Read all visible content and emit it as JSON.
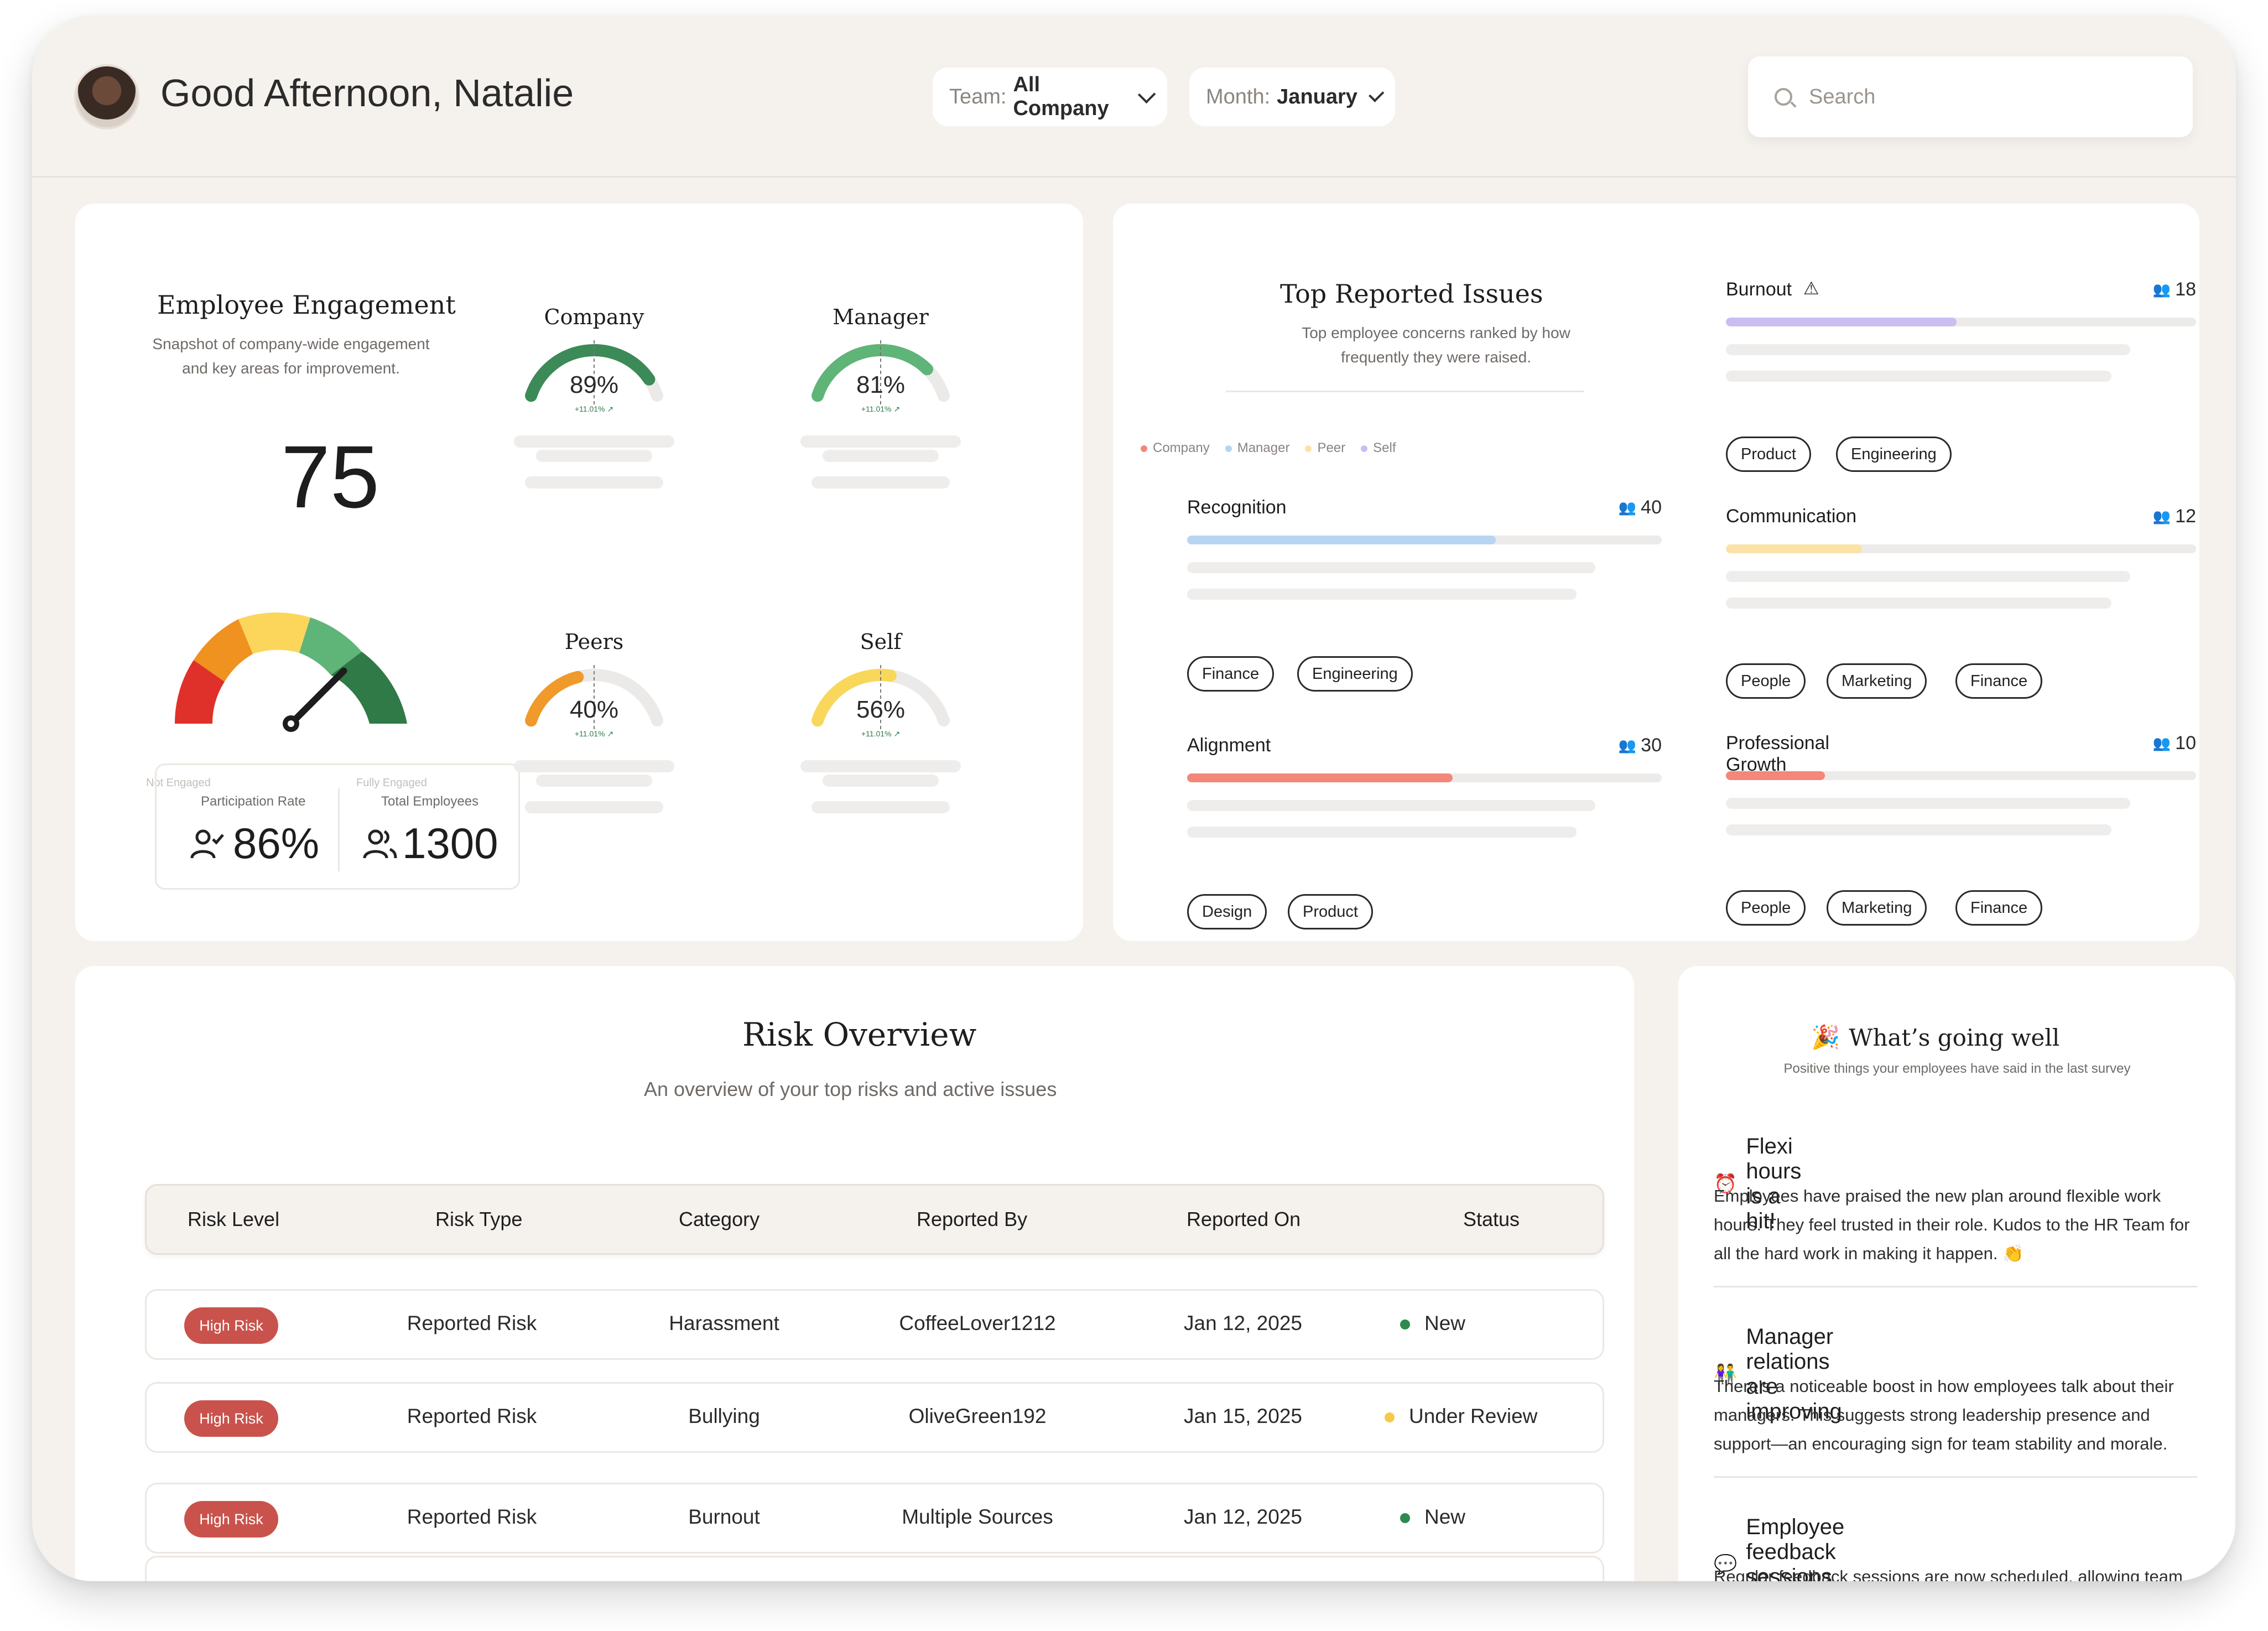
{
  "header": {
    "greeting": "Good Afternoon, Natalie",
    "team_label": "Team:",
    "team_value": "All Company",
    "month_label": "Month:",
    "month_value": "January",
    "search_placeholder": "Search"
  },
  "engagement": {
    "title": "Employee Engagement",
    "subtitle_line1": "Snapshot of company-wide engagement",
    "subtitle_line2": "and key areas for improvement.",
    "score": "75",
    "score_value": 75,
    "min_label": "Not Engaged",
    "max_label": "Fully Engaged",
    "participation_label": "Participation Rate",
    "participation_value": "86%",
    "employees_label": "Total Employees",
    "employees_value": "1300",
    "gauges": [
      {
        "title": "Company",
        "value": "89%",
        "pct": 89,
        "delta": "+11.01% ↗",
        "color": "#3b8a57"
      },
      {
        "title": "Manager",
        "value": "81%",
        "pct": 81,
        "delta": "+11.01% ↗",
        "color": "#5fb478"
      },
      {
        "title": "Peers",
        "value": "40%",
        "pct": 40,
        "delta": "+11.01% ↗",
        "color": "#ef9a2a"
      },
      {
        "title": "Self",
        "value": "56%",
        "pct": 56,
        "delta": "+11.01% ↗",
        "color": "#f8d75a"
      }
    ]
  },
  "issues": {
    "title": "Top Reported Issues",
    "subtitle_line1": "Top employee concerns ranked by how",
    "subtitle_line2": "frequently they were raised.",
    "legend": [
      "Company",
      "Manager",
      "Peer",
      "Self"
    ],
    "legend_colors": [
      "#f2877a",
      "#b7d4f2",
      "#fbe2a6",
      "#cbbdf2"
    ],
    "items": [
      {
        "name": "Recognition",
        "count": "40",
        "fill": 0.65,
        "color": "#b7d4f2",
        "tags": [
          "Finance",
          "Engineering"
        ]
      },
      {
        "name": "Alignment",
        "count": "30",
        "fill": 0.56,
        "color": "#f2877a",
        "tags": [
          "Design",
          "Product"
        ]
      },
      {
        "name": "Burnout",
        "count": "18",
        "fill": 0.49,
        "color": "#cbbdf2",
        "tags": [
          "Product",
          "Engineering"
        ]
      },
      {
        "name": "Communication",
        "count": "12",
        "fill": 0.29,
        "color": "#fbe2a6",
        "tags": [
          "People",
          "Marketing",
          "Finance"
        ]
      },
      {
        "name": "Professional Growth",
        "count": "10",
        "fill": 0.21,
        "color": "#f2877a",
        "tags": [
          "People",
          "Marketing",
          "Finance"
        ]
      }
    ]
  },
  "risk": {
    "title": "Risk Overview",
    "subtitle": "An overview of your top risks and active issues",
    "columns": [
      "Risk Level",
      "Risk Type",
      "Category",
      "Reported By",
      "Reported On",
      "Status"
    ],
    "rows": [
      {
        "level": "High Risk",
        "type": "Reported Risk",
        "category": "Harassment",
        "by": "CoffeeLover1212",
        "on": "Jan 12, 2025",
        "status": "New",
        "status_color": "#2e8a4e"
      },
      {
        "level": "High Risk",
        "type": "Reported Risk",
        "category": "Bullying",
        "by": "OliveGreen192",
        "on": "Jan 15, 2025",
        "status": "Under Review",
        "status_color": "#f7c948"
      },
      {
        "level": "High Risk",
        "type": "Reported Risk",
        "category": "Burnout",
        "by": "Multiple Sources",
        "on": "Jan 12, 2025",
        "status": "New",
        "status_color": "#2e8a4e"
      }
    ]
  },
  "going_well": {
    "emoji": "🎉",
    "title": "What’s going well",
    "subtitle": "Positive things your employees have said in the last survey",
    "items": [
      {
        "icon": "⏰",
        "title": "Flexi hours is a hit!",
        "body": "Employees have praised the new plan around flexible work hours. They feel trusted in their role. Kudos to the HR Team for all the hard work in making it happen. 👏"
      },
      {
        "icon": "👫",
        "title": "Manager relations are improving",
        "body": "There’s a noticeable boost in how employees talk about their managers. This suggests strong leadership presence and support—an encouraging sign for team stability and morale."
      },
      {
        "icon": "💬",
        "title": "Employee feedback sessions implemented",
        "body": "Regular feedback sessions are now scheduled, allowing team"
      }
    ]
  }
}
